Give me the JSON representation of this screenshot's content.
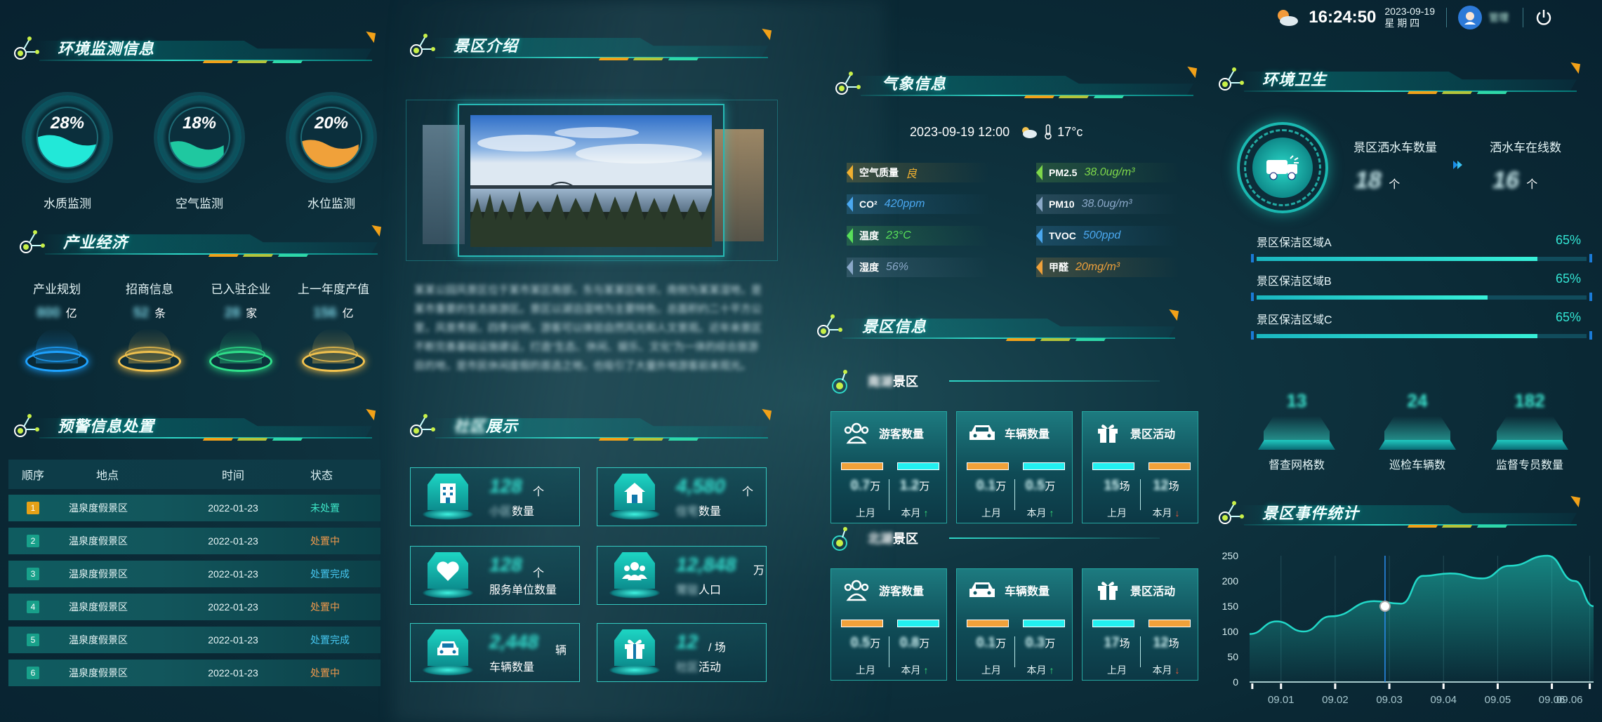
{
  "topbar": {
    "time": "16:24:50",
    "date": "2023-09-19",
    "weekday": "星 期 四",
    "username": "管理"
  },
  "env": {
    "title": "环境监测信息",
    "rings": [
      {
        "pct": "28%",
        "label": "水质监测",
        "fill": 0.28,
        "color": "#22e8d8"
      },
      {
        "pct": "18%",
        "label": "空气监测",
        "fill": 0.18,
        "color": "#1fc8a0"
      },
      {
        "pct": "20%",
        "label": "水位监测",
        "fill": 0.2,
        "color": "#f0a13a"
      }
    ]
  },
  "economy": {
    "title": "产业经济",
    "items": [
      {
        "label": "产业规划",
        "value": "800",
        "unit": "亿",
        "color": "#1ea2ff"
      },
      {
        "label": "招商信息",
        "value": "52",
        "unit": "条",
        "color": "#f2c24e"
      },
      {
        "label": "已入驻企业",
        "value": "28",
        "unit": "家",
        "color": "#2fe08a"
      },
      {
        "label": "上一年度产值",
        "value": "156",
        "unit": "亿",
        "color": "#f2c24e"
      }
    ]
  },
  "warning": {
    "title": "预警信息处置",
    "headers": [
      "顺序",
      "地点",
      "时间",
      "状态"
    ],
    "rows": [
      {
        "no": "1",
        "place": "温泉度假景区",
        "time": "2022-01-23",
        "status": "未处置",
        "color": "#3ee8c8"
      },
      {
        "no": "2",
        "place": "温泉度假景区",
        "time": "2022-01-23",
        "status": "处置中",
        "color": "#f29a4c"
      },
      {
        "no": "3",
        "place": "温泉度假景区",
        "time": "2022-01-23",
        "status": "处置完成",
        "color": "#47c8f2"
      },
      {
        "no": "4",
        "place": "温泉度假景区",
        "time": "2022-01-23",
        "status": "处置中",
        "color": "#f29a4c"
      },
      {
        "no": "5",
        "place": "温泉度假景区",
        "time": "2022-01-23",
        "status": "处置完成",
        "color": "#47c8f2"
      },
      {
        "no": "6",
        "place": "温泉度假景区",
        "time": "2022-01-23",
        "status": "处置中",
        "color": "#f29a4c"
      }
    ]
  },
  "intro": {
    "title": "景区介绍",
    "text": "某某公园风景区位于某市某区南部，东与某某区毗邻，南侧为某某湿地，是某市重要的生态旅游区。景区以湖泊湿地为主要特色，总面积约二十平方公里，风景秀丽，四季分明，游客可以体验自然风光和人文景观。近年来景区不断完善基础设施建设，打造“生态、休闲、娱乐、文化”为一体的综合旅游目的地，是市民休闲度假的首选之地，也吸引了大量外地游客前来观光。"
  },
  "community": {
    "title": "社区展示",
    "cards": [
      {
        "value": "128",
        "unit": "个",
        "sub_blur": "小区",
        "sub": "数量",
        "glyph": "building-icon"
      },
      {
        "value": "4,580",
        "unit": "个",
        "sub_blur": "住宅",
        "sub": "数量",
        "glyph": "house-icon"
      },
      {
        "value": "128",
        "unit": "个",
        "sub_blur": "",
        "sub": "服务单位数量",
        "glyph": "heart-icon"
      },
      {
        "value": "12,848",
        "unit": "万",
        "sub_blur": "常驻",
        "sub": "人口",
        "glyph": "people-icon"
      },
      {
        "value": "2,448",
        "unit": "辆",
        "sub_blur": "",
        "sub": "车辆数量",
        "glyph": "car-icon"
      },
      {
        "value": "12",
        "unit": "/ 场",
        "sub_blur": "社区",
        "sub": "活动",
        "glyph": "gift-icon"
      }
    ]
  },
  "weather": {
    "title": "气象信息",
    "datetime": "2023-09-19 12:00",
    "temp": "17°c",
    "left": [
      {
        "label": "空气质量",
        "value": "良",
        "color": "#f0b030"
      },
      {
        "label": "CO²",
        "value": "420ppm",
        "color": "#4aa8f0"
      },
      {
        "label": "温度",
        "value": "23°C",
        "color": "#58e05a"
      },
      {
        "label": "湿度",
        "value": "56%",
        "color": "#8aa8c8"
      }
    ],
    "right": [
      {
        "label": "PM2.5",
        "value": "38.0ug/m³",
        "color": "#7ed84a"
      },
      {
        "label": "PM10",
        "value": "38.0ug/m³",
        "color": "#8aa8c8"
      },
      {
        "label": "TVOC",
        "value": "500ppd",
        "color": "#4aa8f0"
      },
      {
        "label": "甲醛",
        "value": "20mg/m³",
        "color": "#f0a13a"
      }
    ]
  },
  "scenic": {
    "title": "景区信息",
    "zones": [
      {
        "name_blur": "南湖",
        "name": "景区",
        "cards": [
          {
            "title": "游客数量",
            "glyph": "people-icon",
            "a": "0.7",
            "au": "万",
            "b": "1.2",
            "bu": "万",
            "trend": "↑",
            "dir": "up",
            "bar1": "#f0a13a",
            "bar2": "#22f0f0"
          },
          {
            "title": "车辆数量",
            "glyph": "car-icon",
            "a": "0.1",
            "au": "万",
            "b": "0.5",
            "bu": "万",
            "trend": "↑",
            "dir": "up",
            "bar1": "#f0a13a",
            "bar2": "#22f0f0"
          },
          {
            "title": "景区活动",
            "glyph": "gift-icon",
            "a": "15",
            "au": "场",
            "b": "12",
            "bu": "场",
            "trend": "↓",
            "dir": "down",
            "bar1": "#22f0f0",
            "bar2": "#f0a13a"
          }
        ]
      },
      {
        "name_blur": "北湖",
        "name": "景区",
        "cards": [
          {
            "title": "游客数量",
            "glyph": "people-icon",
            "a": "0.5",
            "au": "万",
            "b": "0.8",
            "bu": "万",
            "trend": "↑",
            "dir": "up",
            "bar1": "#f0a13a",
            "bar2": "#22f0f0"
          },
          {
            "title": "车辆数量",
            "glyph": "car-icon",
            "a": "0.1",
            "au": "万",
            "b": "0.3",
            "bu": "万",
            "trend": "↑",
            "dir": "up",
            "bar1": "#f0a13a",
            "bar2": "#22f0f0"
          },
          {
            "title": "景区活动",
            "glyph": "gift-icon",
            "a": "17",
            "au": "场",
            "b": "12",
            "bu": "场",
            "trend": "↓",
            "dir": "down",
            "bar1": "#22f0f0",
            "bar2": "#f0a13a"
          }
        ]
      }
    ],
    "last_month": "上月",
    "this_month": "本月"
  },
  "hygiene": {
    "title": "环境卫生",
    "trucks_label": "景区洒水车数量",
    "trucks_value": "18",
    "trucks_unit": "个",
    "online_label": "洒水车在线数",
    "online_value": "16",
    "online_unit": "个",
    "zones": [
      {
        "label": "景区保洁区域A",
        "pct": "65%",
        "fill": 0.85
      },
      {
        "label": "景区保洁区域B",
        "pct": "65%",
        "fill": 0.7
      },
      {
        "label": "景区保洁区域C",
        "pct": "65%",
        "fill": 0.85
      }
    ],
    "stats": [
      {
        "value": "13",
        "label": "督查网格数"
      },
      {
        "value": "24",
        "label": "巡检车辆数"
      },
      {
        "value": "182",
        "label": "监督专员数量"
      }
    ]
  },
  "events": {
    "title": "景区事件统计"
  },
  "chart_data": {
    "type": "area",
    "x": [
      "09.01",
      "09.02",
      "09.03",
      "09.04",
      "09.05",
      "09.06",
      "09.06"
    ],
    "series": [
      {
        "values": [
          95,
          120,
          100,
          130,
          160,
          155,
          210,
          215,
          205,
          230,
          250,
          200,
          150
        ]
      }
    ],
    "x_points": [
      0,
      0.5,
      1,
      1.5,
      2.3,
      2.8,
      3.2,
      3.7,
      4.3,
      4.8,
      5.5,
      6.0,
      6.35
    ],
    "yticks": [
      "0",
      "50",
      "100",
      "150",
      "200",
      "250"
    ],
    "ylim": [
      0,
      250
    ],
    "highlight_x": 2.5,
    "grid": true
  }
}
